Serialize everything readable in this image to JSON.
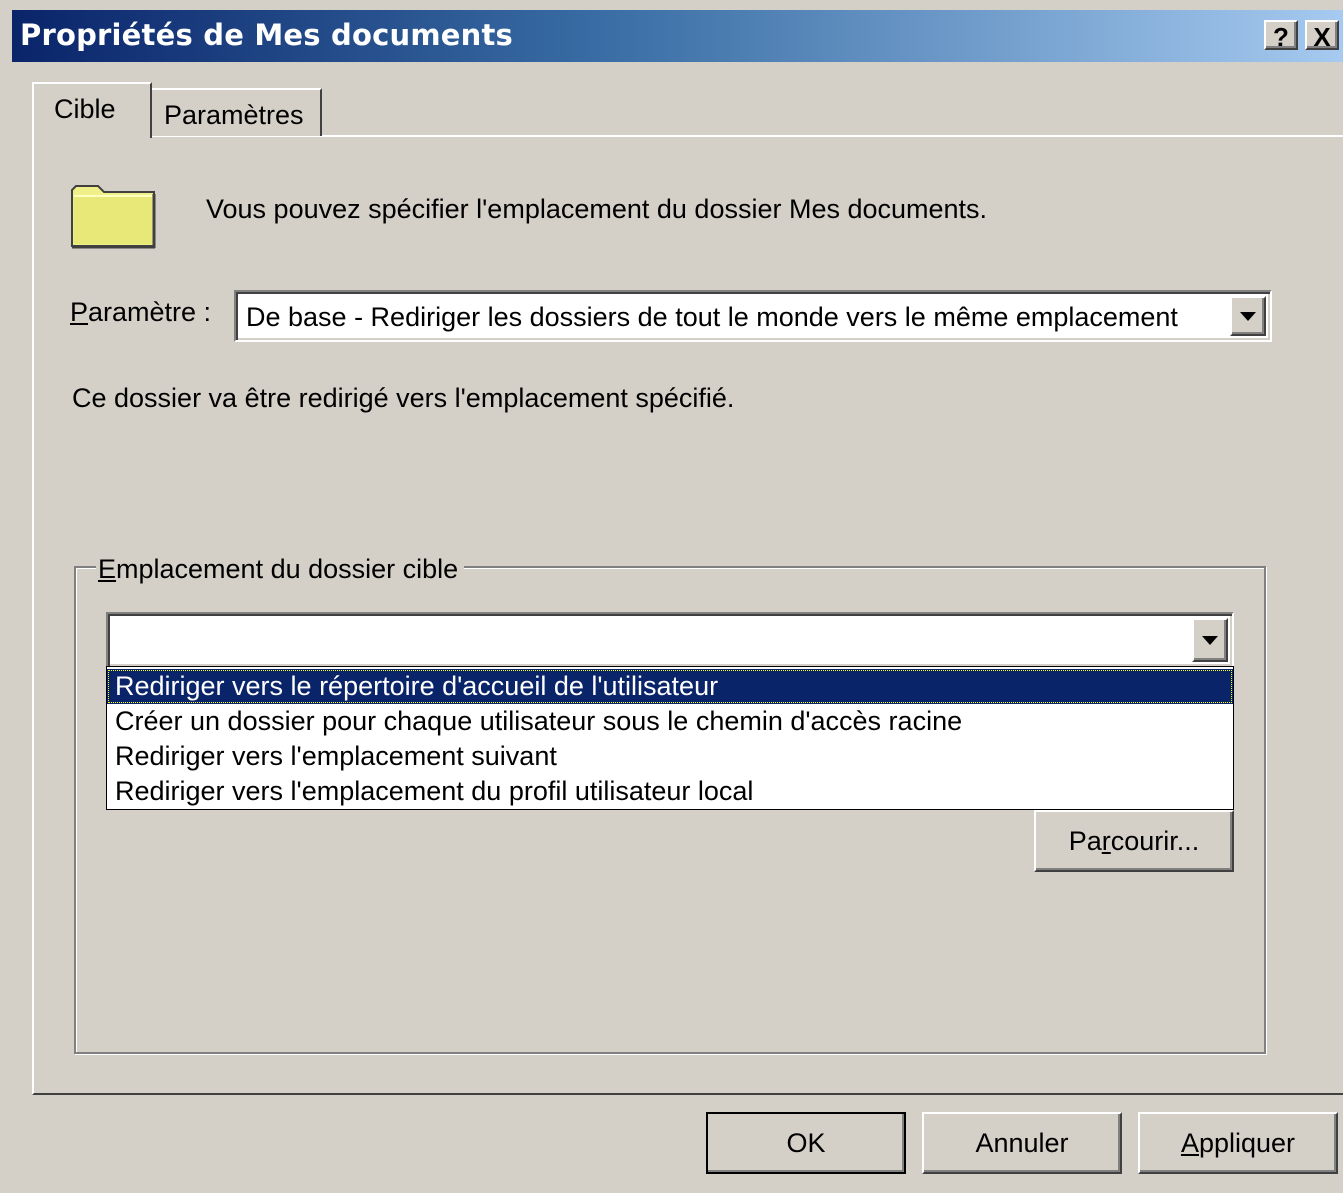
{
  "window": {
    "title": "Propriétés de Mes documents",
    "help_label": "?",
    "close_label": "X"
  },
  "tabs": [
    {
      "label": "Cible",
      "active": true
    },
    {
      "label": "Paramètres",
      "active": false
    }
  ],
  "target_tab": {
    "description": "Vous pouvez spécifier l'emplacement du dossier Mes documents.",
    "setting_label_accel": "P",
    "setting_label_rest": "aramètre :",
    "setting_value": "De base - Rediriger les dossiers de tout le monde vers le même emplacement",
    "info_text": "Ce dossier va être redirigé vers l'emplacement spécifié.",
    "group": {
      "label_accel": "E",
      "label_rest": "mplacement du dossier cible",
      "combo_value": "",
      "options": [
        "Rediriger vers le répertoire d'accueil de l'utilisateur",
        "Créer un dossier pour chaque utilisateur sous le chemin d'accès racine",
        "Rediriger vers l'emplacement suivant",
        "Rediriger vers l'emplacement du profil utilisateur local"
      ],
      "selected_index": 0,
      "browse_pre": "Pa",
      "browse_accel": "r",
      "browse_post": "courir..."
    }
  },
  "footer": {
    "ok_label": "OK",
    "cancel_label": "Annuler",
    "apply_accel": "A",
    "apply_rest": "ppliquer"
  },
  "colors": {
    "face": "#d4d0c8",
    "title_start": "#0a246a",
    "title_end": "#a6caf0",
    "selection": "#0a246a",
    "folder": "#f0f08a"
  }
}
